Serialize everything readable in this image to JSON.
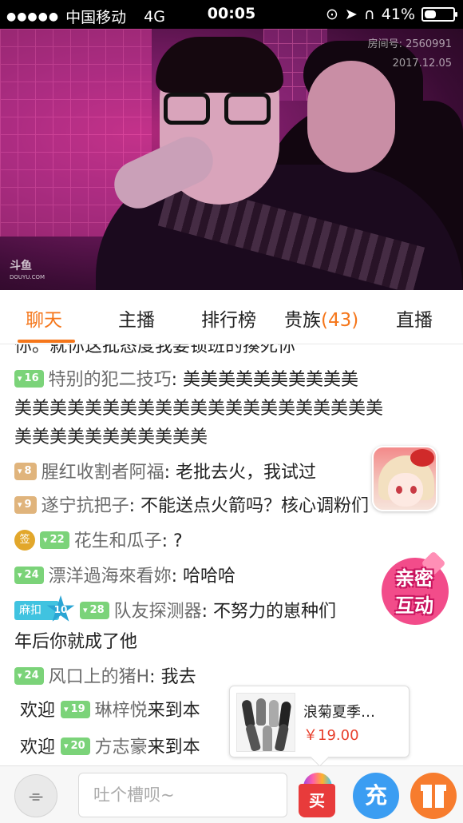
{
  "status_bar": {
    "carrier": "中国移动",
    "network": "4G",
    "time": "00:05",
    "battery": "41%",
    "battery_level": 0.41
  },
  "video": {
    "room_id": "房间号: 2560991",
    "date": "2017.12.05",
    "watermark": "斗鱼",
    "watermark_sub": "DOUYU.COM"
  },
  "tabs": {
    "chat": "聊天",
    "anchor": "主播",
    "ranking": "排行榜",
    "nobility": "贵族",
    "nobility_count": "(43)",
    "live": "直播"
  },
  "chat": {
    "partial_top": "你。就你这批态度我要锁班的揍死你",
    "messages": [
      {
        "level": "16",
        "name": "特别的犯二技巧",
        "text": "美美美美美美美美美美"
      },
      {
        "text_line2": "美美美美美美美美美美美美美美美美美美美美美"
      },
      {
        "text_line3": "美美美美美美美美美美美"
      },
      {
        "level": "8",
        "name": "腥红收割者阿福",
        "text": "老批去火，我试过"
      },
      {
        "level": "9",
        "name": "遂宁抗把子",
        "text": "不能送点火箭吗？核心调粉们"
      },
      {
        "badge": "签",
        "level": "22",
        "name": "花生和瓜子",
        "text": "?"
      },
      {
        "level": "24",
        "name": "漂洋過海來看妳",
        "text": "哈哈哈"
      },
      {
        "fan_badge": "麻扣",
        "fan_level": "10",
        "level": "28",
        "name": "队友探测器",
        "text": "不努力的崽种们"
      },
      {
        "text_line2": "年后你就成了他"
      },
      {
        "level": "24",
        "name": "风口上的猪H",
        "text": "我去"
      }
    ],
    "welcomes": [
      {
        "prefix": "欢迎",
        "level": "19",
        "name": "琳梓悦",
        "suffix": "来到本"
      },
      {
        "prefix": "欢迎",
        "level": "20",
        "name": "方志豪",
        "suffix": "来到本"
      }
    ]
  },
  "interact": {
    "line1": "亲密",
    "line2": "互动"
  },
  "product": {
    "title": "浪菊夏季…",
    "price": "￥19.00"
  },
  "bottom": {
    "input_placeholder": "吐个槽呗~",
    "buy_label": "买",
    "charge_label": "充"
  },
  "colors": {
    "accent": "#f5761a",
    "level_green": "#7bd379",
    "level_tan": "#e0b47c",
    "price_red": "#e8402d",
    "charge_blue": "#3b9df2",
    "gift_orange": "#f77c2e"
  }
}
